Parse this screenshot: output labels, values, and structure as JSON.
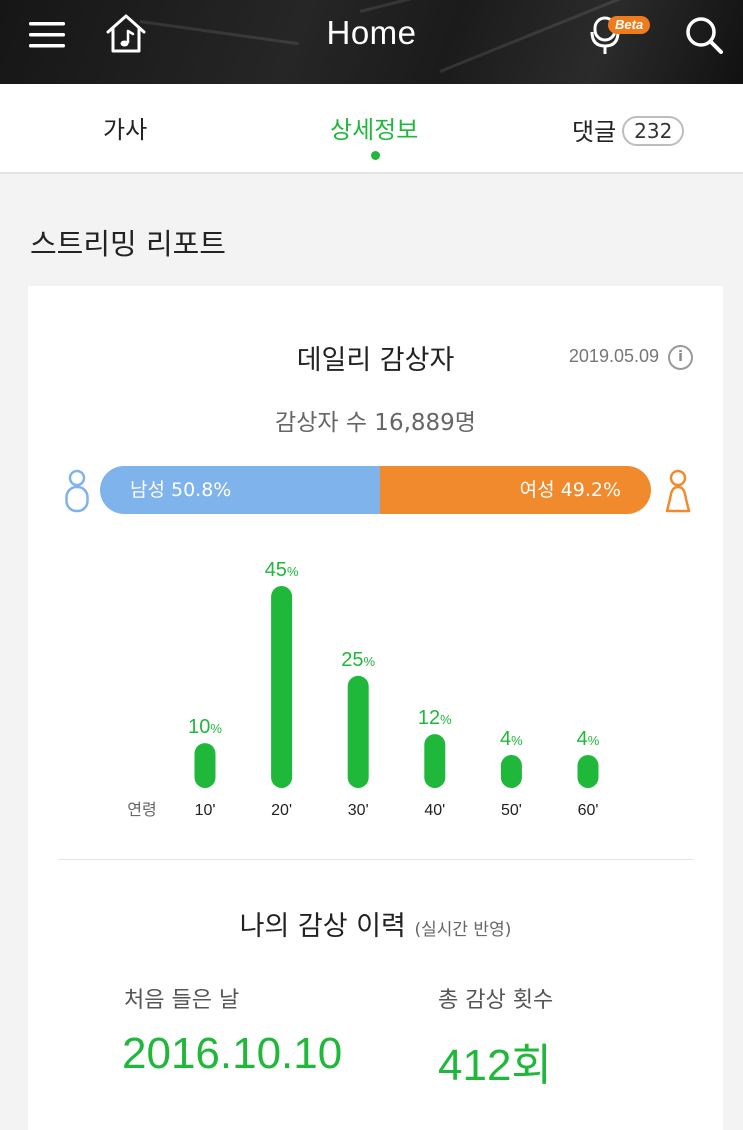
{
  "header": {
    "title": "Home",
    "beta_label": "Beta",
    "icons": [
      "menu-icon",
      "home-music-icon",
      "mic-icon",
      "search-icon"
    ]
  },
  "tabs": [
    {
      "label": "가사",
      "active": false
    },
    {
      "label": "상세정보",
      "active": true
    },
    {
      "label": "댓글",
      "active": false,
      "count": "232"
    }
  ],
  "section": {
    "title": "스트리밍 리포트"
  },
  "daily": {
    "title": "데일리 감상자",
    "date": "2019.05.09",
    "listener_count": "감상자 수 16,889명",
    "male_label": "남성 50.8%",
    "female_label": "여성 49.2%",
    "male_share": 50.8,
    "female_share": 49.2,
    "colors": {
      "male": "#7eb3ec",
      "female": "#f08a2d",
      "accent": "#1fb83b"
    }
  },
  "chart_data": {
    "type": "bar",
    "title": "",
    "xlabel": "연령",
    "ylabel": "",
    "categories": [
      "10'",
      "20'",
      "30'",
      "40'",
      "50'",
      "60'"
    ],
    "values": [
      10,
      45,
      25,
      12,
      4,
      4
    ],
    "unit": "%",
    "ylim": [
      0,
      45
    ],
    "grid": false
  },
  "history": {
    "title": "나의 감상 이력",
    "subtitle": "(실시간 반영)",
    "first_listen_label": "처음 들은 날",
    "first_listen_value": "2016.10.10",
    "total_plays_label": "총 감상 횟수",
    "total_plays_value": "412회"
  }
}
